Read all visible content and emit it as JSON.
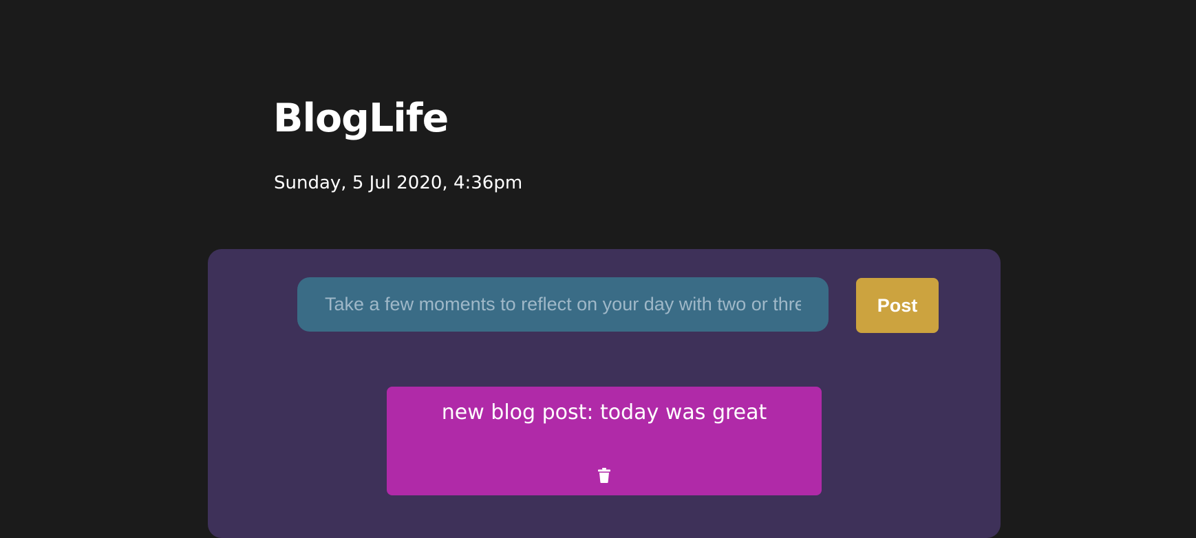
{
  "header": {
    "title": "BlogLife",
    "date": "Sunday, 5 Jul 2020, 4:36pm"
  },
  "composer": {
    "placeholder": "Take a few moments to reflect on your day with two or three sentences",
    "value": "",
    "post_label": "Post"
  },
  "posts": [
    {
      "text": "new blog post: today was great",
      "delete_icon": "trash-icon"
    }
  ],
  "colors": {
    "background": "#1b1b1b",
    "panel": "#3e3159",
    "input": "#3a6c86",
    "post_button": "#cca33f",
    "post_card": "#b02aa8"
  }
}
